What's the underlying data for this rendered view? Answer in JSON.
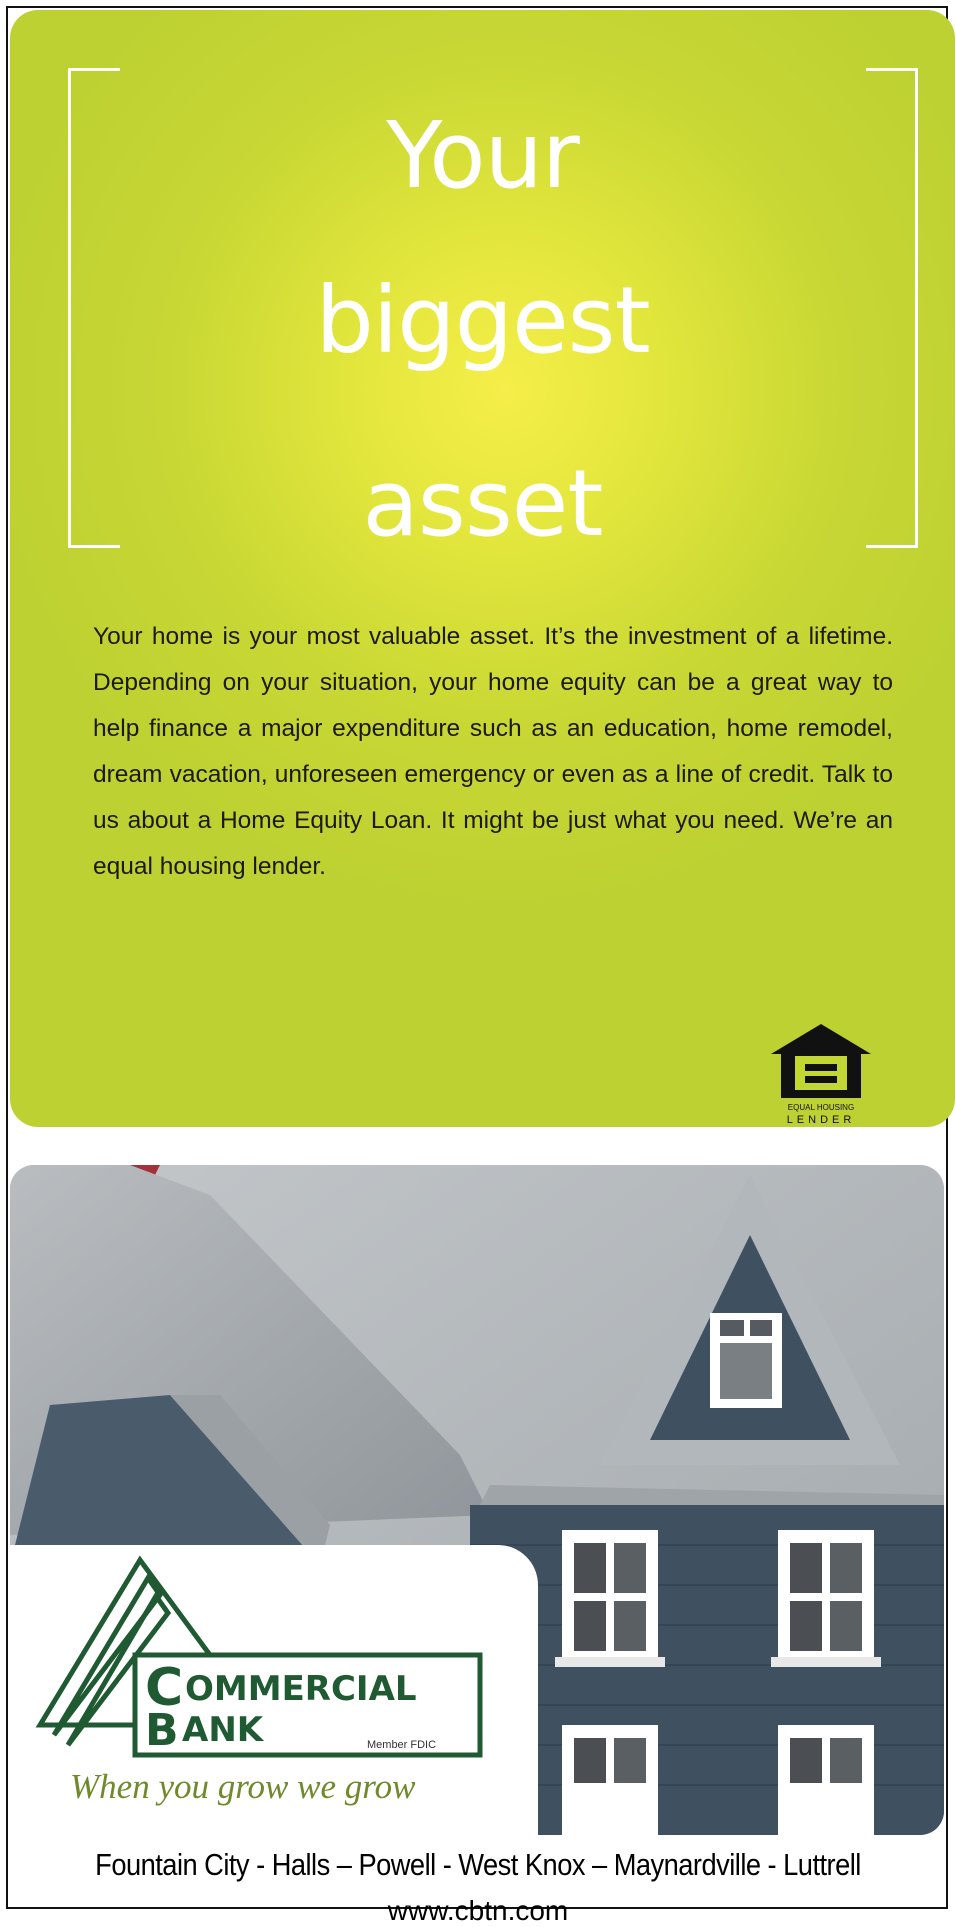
{
  "headline": {
    "line1": "Your",
    "line2": "biggest",
    "line3": "asset"
  },
  "body_text": "Your home is your most valuable asset. It’s the investment of a lifetime. Depending on your situation, your home equity can be a great way to help finance a major expenditure such as an education, home remodel, dream vacation, unforeseen emergency or even as a line of credit. Talk to us about a Home Equity Loan. It might be just what you need. We’re an equal housing lender.",
  "equal_housing": {
    "small_text": "EQUAL HOUSING",
    "large_text": "LENDER"
  },
  "bank": {
    "name_line1": "OMMERCIAL",
    "name_line2": "ANK",
    "initial1": "C",
    "initial2": "B",
    "member": "Member FDIC",
    "tagline": "When you grow we grow"
  },
  "locations": "Fountain City - Halls – Powell - West Knox – Maynardville - Luttrell",
  "url": "www.cbtn.com",
  "colors": {
    "panel_green": "#c8d734",
    "house_siding": "#3f5161",
    "roof_gray": "#a9aeb2",
    "logo_green": "#1f5a32"
  }
}
